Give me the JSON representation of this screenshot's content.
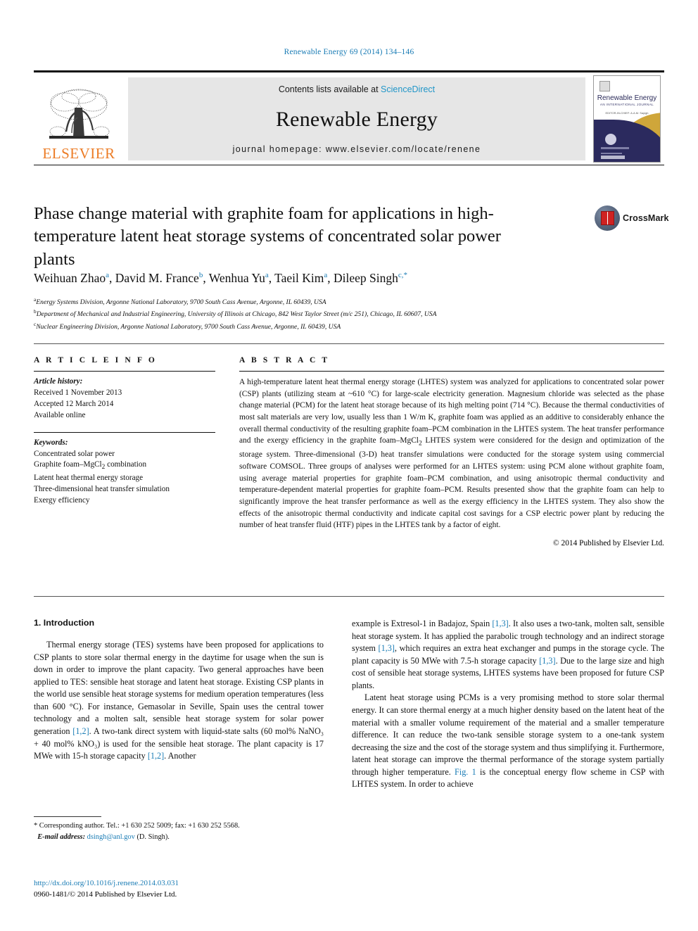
{
  "running_head": "Renewable Energy 69 (2014) 134–146",
  "masthead": {
    "publisher_name": "ELSEVIER",
    "publisher_logo_icon": "elsevier-tree-logo",
    "contents_prefix": "Contents lists available at ",
    "contents_link": "ScienceDirect",
    "journal_title": "Renewable Energy",
    "journal_homepage": "journal homepage: www.elsevier.com/locate/renene",
    "cover": {
      "title": "Renewable Energy",
      "subtitle": "AN INTERNATIONAL JOURNAL",
      "byline": "EDITOR-IN-CHIEF: A.A.M. Sayigh"
    }
  },
  "article": {
    "title": "Phase change material with graphite foam for applications in high-temperature latent heat storage systems of concentrated solar power plants",
    "crossmark_label": "CrossMark",
    "authors_html": "Weihuan Zhao<sup>a</sup>, David M. France<sup>b</sup>, Wenhua Yu<sup>a</sup>, Taeil Kim<sup>a</sup>, Dileep Singh<sup>c,*</sup>",
    "affiliations": [
      "Energy Systems Division, Argonne National Laboratory, 9700 South Cass Avenue, Argonne, IL 60439, USA",
      "Department of Mechanical and Industrial Engineering, University of Illinois at Chicago, 842 West Taylor Street (m/c 251), Chicago, IL 60607, USA",
      "Nuclear Engineering Division, Argonne National Laboratory, 9700 South Cass Avenue, Argonne, IL 60439, USA"
    ],
    "affiliation_marks": [
      "a",
      "b",
      "c"
    ]
  },
  "article_info": {
    "heading": "A R T I C L E  I N F O",
    "history_label": "Article history:",
    "history": [
      "Received 1 November 2013",
      "Accepted 12 March 2014",
      "Available online"
    ],
    "keywords_label": "Keywords:",
    "keywords": [
      "Concentrated solar power",
      "Graphite foam–MgCl₂ combination",
      "Latent heat thermal energy storage",
      "Three-dimensional heat transfer simulation",
      "Exergy efficiency"
    ]
  },
  "abstract": {
    "heading": "A B S T R A C T",
    "text": "A high-temperature latent heat thermal energy storage (LHTES) system was analyzed for applications to concentrated solar power (CSP) plants (utilizing steam at ~610 °C) for large-scale electricity generation. Magnesium chloride was selected as the phase change material (PCM) for the latent heat storage because of its high melting point (714 °C). Because the thermal conductivities of most salt materials are very low, usually less than 1 W/m K, graphite foam was applied as an additive to considerably enhance the overall thermal conductivity of the resulting graphite foam–PCM combination in the LHTES system. The heat transfer performance and the exergy efficiency in the graphite foam–MgCl₂ LHTES system were considered for the design and optimization of the storage system. Three-dimensional (3-D) heat transfer simulations were conducted for the storage system using commercial software COMSOL. Three groups of analyses were performed for an LHTES system: using PCM alone without graphite foam, using average material properties for graphite foam–PCM combination, and using anisotropic thermal conductivity and temperature-dependent material properties for graphite foam–PCM. Results presented show that the graphite foam can help to significantly improve the heat transfer performance as well as the exergy efficiency in the LHTES system. They also show the effects of the anisotropic thermal conductivity and indicate capital cost savings for a CSP electric power plant by reducing the number of heat transfer fluid (HTF) pipes in the LHTES tank by a factor of eight.",
    "copyright": "© 2014 Published by Elsevier Ltd."
  },
  "introduction": {
    "section_number_title": "1. Introduction",
    "left_paragraph_1": "Thermal energy storage (TES) systems have been proposed for applications to CSP plants to store solar thermal energy in the daytime for usage when the sun is down in order to improve the plant capacity. Two general approaches have been applied to TES: sensible heat storage and latent heat storage. Existing CSP plants in the world use sensible heat storage systems for medium operation temperatures (less than 600 °C). For instance, Gemasolar in Seville, Spain uses the central tower technology and a molten salt, sensible heat storage system for solar power generation [1,2]. A two-tank direct system with liquid-state salts (60 mol% NaNO₃ + 40 mol% kNO₃) is used for the sensible heat storage. The plant capacity is 17 MWe with 15-h storage capacity [1,2]. Another",
    "right_paragraph_1": "example is Extresol-1 in Badajoz, Spain [1,3]. It also uses a two-tank, molten salt, sensible heat storage system. It has applied the parabolic trough technology and an indirect storage system [1,3], which requires an extra heat exchanger and pumps in the storage cycle. The plant capacity is 50 MWe with 7.5-h storage capacity [1,3]. Due to the large size and high cost of sensible heat storage systems, LHTES systems have been proposed for future CSP plants.",
    "right_paragraph_2": "Latent heat storage using PCMs is a very promising method to store solar thermal energy. It can store thermal energy at a much higher density based on the latent heat of the material with a smaller volume requirement of the material and a smaller temperature difference. It can reduce the two-tank sensible storage system to a one-tank system decreasing the size and the cost of the storage system and thus simplifying it. Furthermore, latent heat storage can improve the thermal performance of the storage system partially through higher temperature. Fig. 1 is the conceptual energy flow scheme in CSP with LHTES system. In order to achieve",
    "inline_refs": [
      "[1,2]",
      "[1,3]",
      "Fig. 1"
    ]
  },
  "footnote": {
    "corresponding": "* Corresponding author. Tel.: +1 630 252 5009; fax: +1 630 252 5568.",
    "email_label": "E-mail address:",
    "email": "dsingh@anl.gov",
    "email_suffix": "(D. Singh)."
  },
  "footer": {
    "doi": "http://dx.doi.org/10.1016/j.renene.2014.03.031",
    "issn_line": "0960-1481/© 2014 Published by Elsevier Ltd."
  },
  "colors": {
    "link": "#1a7cb5",
    "elsevier_orange": "#ec7c26",
    "banner_grey": "#e6e6e6",
    "cover_navy": "#2b2a5e",
    "cover_gold": "#cfa63a"
  }
}
